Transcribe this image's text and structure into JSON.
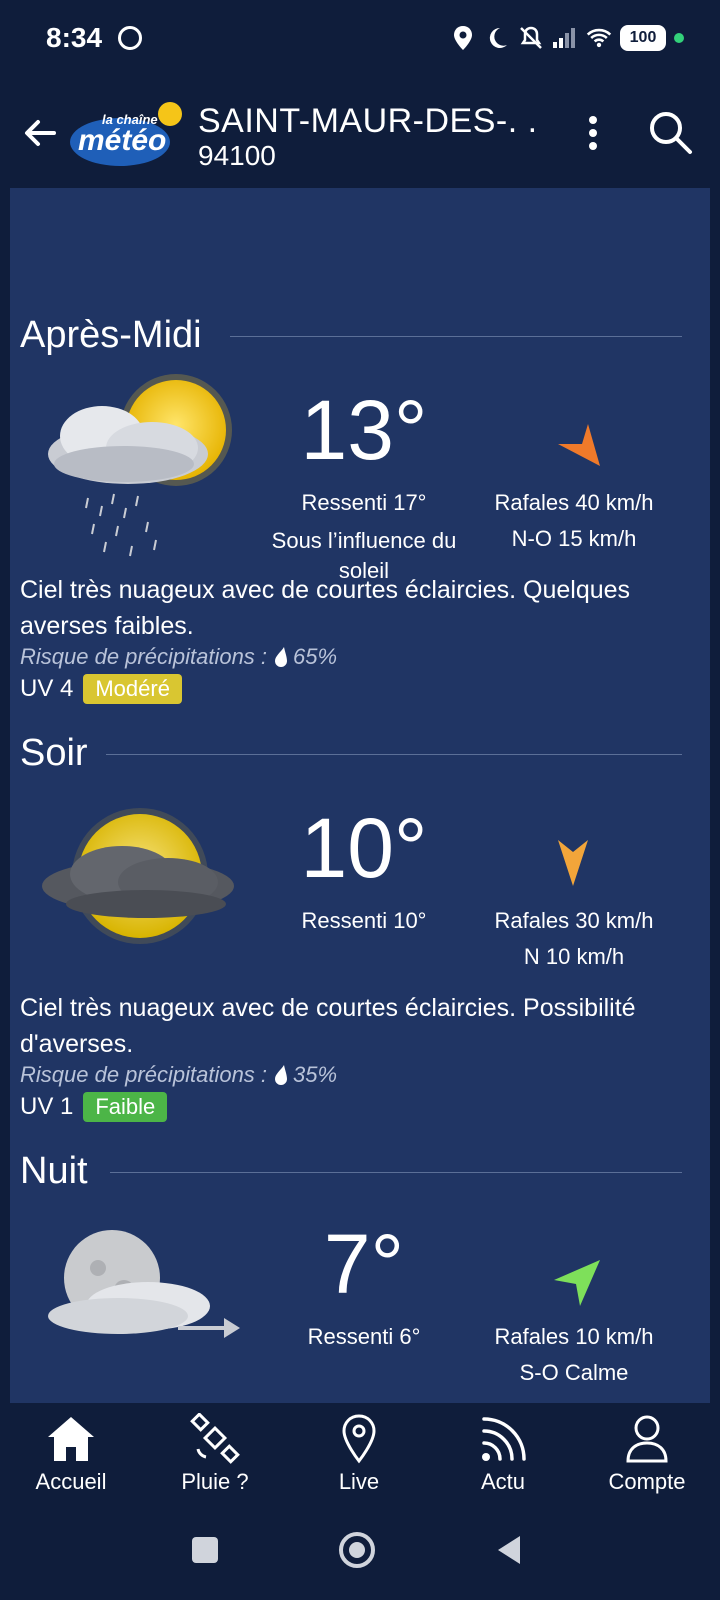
{
  "status_bar": {
    "time": "8:34",
    "battery": "100"
  },
  "app_bar": {
    "city": "SAINT-MAUR-DES-. .",
    "zip": "94100",
    "logo_line1": "la chaîne",
    "logo_line2": "météo"
  },
  "sections": [
    {
      "title": "Après-Midi",
      "temperature": "13°",
      "feels_like": "Ressenti 17°",
      "note": "Sous l’influence du soleil",
      "gusts": "Rafales 40 km/h",
      "wind": "N-O 15 km/h",
      "wind_arrow_color": "#f07a2a",
      "description": "Ciel très nuageux avec de courtes éclaircies. Quelques averses faibles.",
      "precip_label": "Risque de précipitations :",
      "precip_value": "65%",
      "uv_label": "UV 4",
      "uv_level": "Modéré",
      "uv_color": "#d9c631",
      "icon": "cloud-sun-rain-icon"
    },
    {
      "title": "Soir",
      "temperature": "10°",
      "feels_like": "Ressenti 10°",
      "gusts": "Rafales 30 km/h",
      "wind": "N 10 km/h",
      "wind_arrow_color": "#f2a53a",
      "description": "Ciel très nuageux avec de courtes éclaircies. Possibilité d'averses.",
      "precip_label": "Risque de précipitations :",
      "precip_value": "35%",
      "uv_label": "UV 1",
      "uv_level": "Faible",
      "uv_color": "#4cb547",
      "icon": "moon-cloud-icon"
    },
    {
      "title": "Nuit",
      "temperature": "7°",
      "feels_like": "Ressenti 6°",
      "gusts": "Rafales 10 km/h",
      "wind": "S-O Calme",
      "wind_arrow_color": "#7ee05a",
      "icon": "moon-cloud-wind-icon"
    }
  ],
  "bottom_nav": [
    {
      "label": "Accueil",
      "icon": "home-icon"
    },
    {
      "label": "Pluie ?",
      "icon": "satellite-icon"
    },
    {
      "label": "Live",
      "icon": "location-pin-icon"
    },
    {
      "label": "Actu",
      "icon": "rss-icon"
    },
    {
      "label": "Compte",
      "icon": "user-icon"
    }
  ],
  "colors": {
    "background": "#0f1d3b",
    "panel": "#203564",
    "accent_sun": "#f5c518"
  }
}
